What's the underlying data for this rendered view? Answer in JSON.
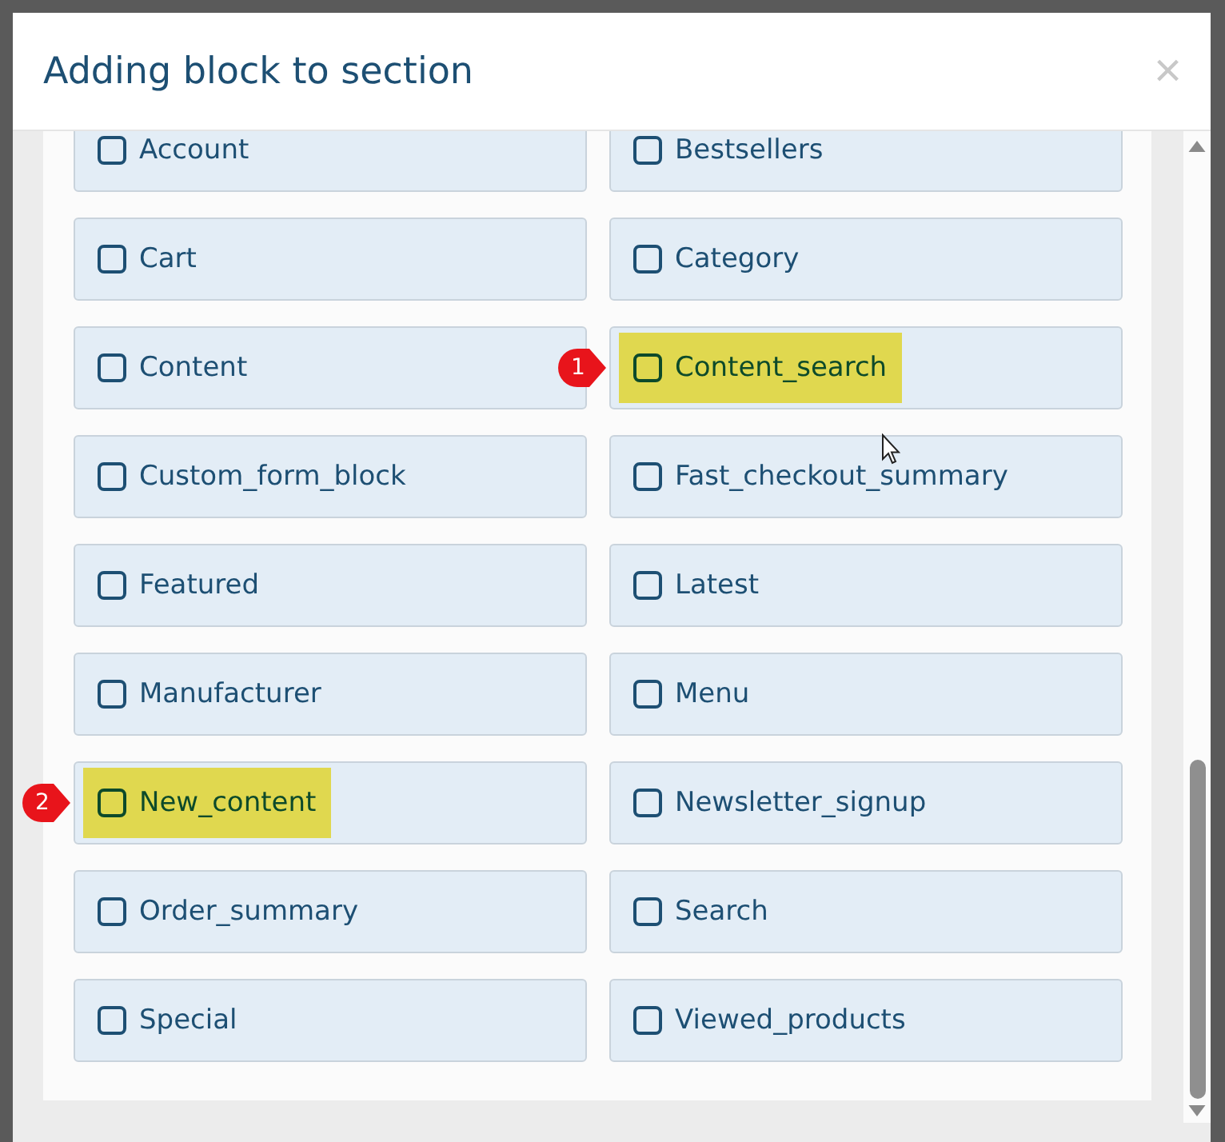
{
  "dialog": {
    "title": "Adding block to section",
    "close": "×"
  },
  "blocks": [
    {
      "label": "Account",
      "checked": false,
      "highlighted": false
    },
    {
      "label": "Bestsellers",
      "checked": false,
      "highlighted": false
    },
    {
      "label": "Cart",
      "checked": false,
      "highlighted": false
    },
    {
      "label": "Category",
      "checked": false,
      "highlighted": false
    },
    {
      "label": "Content",
      "checked": false,
      "highlighted": false
    },
    {
      "label": "Content_search",
      "checked": false,
      "highlighted": true,
      "marker": "1"
    },
    {
      "label": "Custom_form_block",
      "checked": false,
      "highlighted": false
    },
    {
      "label": "Fast_checkout_summary",
      "checked": false,
      "highlighted": false
    },
    {
      "label": "Featured",
      "checked": false,
      "highlighted": false
    },
    {
      "label": "Latest",
      "checked": false,
      "highlighted": false
    },
    {
      "label": "Manufacturer",
      "checked": false,
      "highlighted": false
    },
    {
      "label": "Menu",
      "checked": false,
      "highlighted": false
    },
    {
      "label": "New_content",
      "checked": false,
      "highlighted": true,
      "marker": "2"
    },
    {
      "label": "Newsletter_signup",
      "checked": false,
      "highlighted": false
    },
    {
      "label": "Order_summary",
      "checked": false,
      "highlighted": false
    },
    {
      "label": "Search",
      "checked": false,
      "highlighted": false
    },
    {
      "label": "Special",
      "checked": false,
      "highlighted": false
    },
    {
      "label": "Viewed_products",
      "checked": false,
      "highlighted": false
    }
  ]
}
